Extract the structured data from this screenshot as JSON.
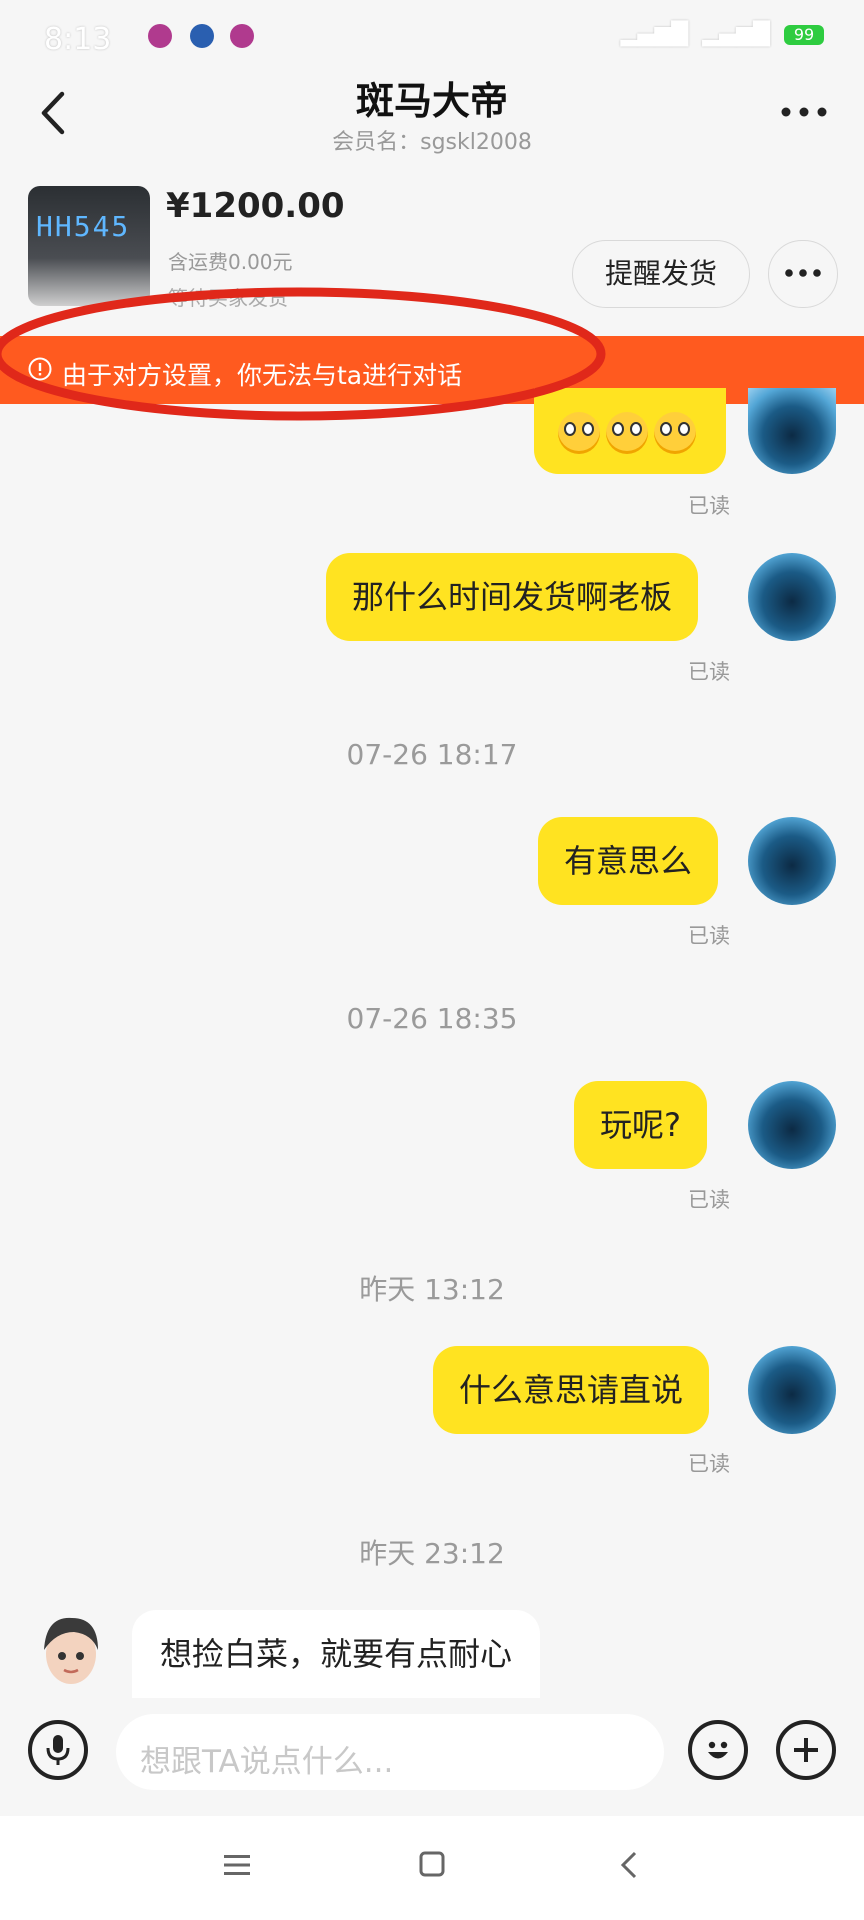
{
  "status_bar": {
    "time": "8:13",
    "battery": "99"
  },
  "header": {
    "title": "斑马大帝",
    "subtitle": "会员名：sgskl2008"
  },
  "product": {
    "thumb_text": "HH545",
    "price": "¥1200.00",
    "shipping": "含运费0.00元",
    "note": "等待买家发货",
    "remind_label": "提醒发货"
  },
  "banner": {
    "text": "由于对方设置，你无法与ta进行对话",
    "color": "#ff5a1f"
  },
  "chat": {
    "read_label": "已读",
    "messages": [
      {
        "text": "那什么时间发货啊老板"
      },
      {
        "text": "有意思么"
      },
      {
        "text": "玩呢?"
      },
      {
        "text": "什么意思请直说"
      },
      {
        "text": "想捡白菜，就要有点耐心"
      }
    ],
    "timestamps": [
      "07-26 18:17",
      "07-26 18:35",
      "昨天 13:12",
      "昨天 23:12"
    ]
  },
  "input": {
    "placeholder": "想跟TA说点什么..."
  },
  "colors": {
    "bubble_out": "#ffe321",
    "bubble_in": "#ffffff",
    "annotation": "#e0281a"
  }
}
